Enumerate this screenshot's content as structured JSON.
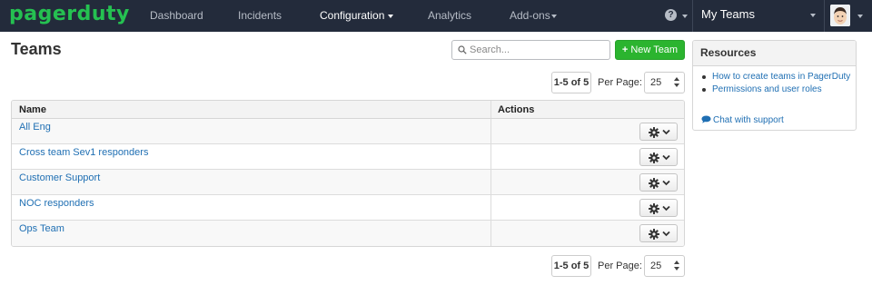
{
  "nav": {
    "logo": "pagerduty",
    "items": [
      "Dashboard",
      "Incidents",
      "Configuration",
      "Analytics",
      "Add-ons"
    ],
    "help_glyph": "?",
    "team_switcher": "My Teams",
    "bg_color": "#232b3b",
    "logo_color": "#25c151"
  },
  "page": {
    "title": "Teams",
    "search_placeholder": "Search...",
    "new_team_label": "New Team",
    "new_team_color": "#2bb42f"
  },
  "pagination": {
    "range": "1-5 of 5",
    "per_page_label": "Per Page:",
    "per_page_value": "25"
  },
  "table": {
    "columns": [
      "Name",
      "Actions"
    ],
    "rows": [
      {
        "name": "All Eng"
      },
      {
        "name": "Cross team Sev1 responders"
      },
      {
        "name": "Customer Support"
      },
      {
        "name": "NOC responders"
      },
      {
        "name": "Ops Team"
      }
    ],
    "row_action_icon": "gear-icon"
  },
  "resources": {
    "title": "Resources",
    "links": [
      "How to create teams in PagerDuty",
      "Permissions and user roles"
    ],
    "chat_label": "Chat with support",
    "link_color": "#1f6fb3"
  }
}
